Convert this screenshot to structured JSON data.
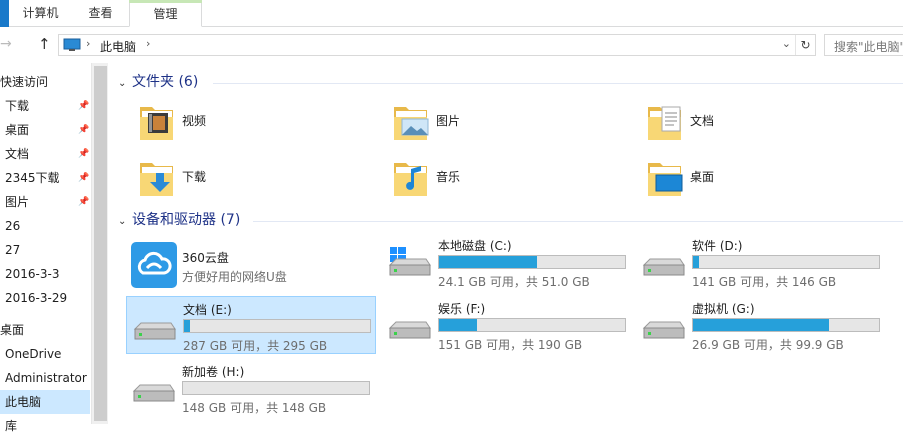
{
  "ribbon": {
    "tabs": [
      "计算机",
      "查看",
      "管理"
    ]
  },
  "address": {
    "crumb": "此电脑",
    "search_placeholder": "搜索\"此电脑\""
  },
  "sidebar": {
    "items": [
      {
        "label": "快速访问",
        "pinned": false
      },
      {
        "label": "下载",
        "pinned": true
      },
      {
        "label": "桌面",
        "pinned": true
      },
      {
        "label": "文档",
        "pinned": true
      },
      {
        "label": "2345下载",
        "pinned": true
      },
      {
        "label": "图片",
        "pinned": true
      },
      {
        "label": "26",
        "pinned": false
      },
      {
        "label": "27",
        "pinned": false
      },
      {
        "label": "2016-3-3",
        "pinned": false
      },
      {
        "label": "2016-3-29",
        "pinned": false
      },
      {
        "label": "桌面",
        "pinned": false
      },
      {
        "label": "OneDrive",
        "pinned": false
      },
      {
        "label": "Administrator",
        "pinned": false
      },
      {
        "label": "此电脑",
        "pinned": false,
        "selected": true
      },
      {
        "label": "库",
        "pinned": false
      }
    ]
  },
  "main": {
    "folders_header": "文件夹 (6)",
    "folders": [
      {
        "name": "视频",
        "icon": "video-folder-icon"
      },
      {
        "name": "图片",
        "icon": "pictures-folder-icon"
      },
      {
        "name": "文档",
        "icon": "documents-folder-icon"
      },
      {
        "name": "下载",
        "icon": "downloads-folder-icon"
      },
      {
        "name": "音乐",
        "icon": "music-folder-icon"
      },
      {
        "name": "桌面",
        "icon": "desktop-folder-icon"
      }
    ],
    "devices_header": "设备和驱动器 (7)",
    "cloud": {
      "name": "360云盘",
      "sub": "方便好用的网络U盘"
    },
    "drives": [
      {
        "name": "本地磁盘 (C:)",
        "info": "24.1 GB 可用，共 51.0 GB",
        "used_fraction": 0.527,
        "windows": true
      },
      {
        "name": "软件 (D:)",
        "info": "141 GB 可用，共 146 GB",
        "used_fraction": 0.034
      },
      {
        "name": "文档 (E:)",
        "info": "287 GB 可用，共 295 GB",
        "used_fraction": 0.027,
        "selected": true
      },
      {
        "name": "娱乐 (F:)",
        "info": "151 GB 可用，共 190 GB",
        "used_fraction": 0.205
      },
      {
        "name": "虚拟机 (G:)",
        "info": "26.9 GB 可用，共 99.9 GB",
        "used_fraction": 0.731
      },
      {
        "name": "新加卷 (H:)",
        "info": "148 GB 可用，共 148 GB",
        "used_fraction": 0.0
      }
    ]
  },
  "colors": {
    "accent": "#26a0da",
    "selection": "#cce8ff",
    "header": "#1e3287",
    "folder": "#f8d775"
  }
}
